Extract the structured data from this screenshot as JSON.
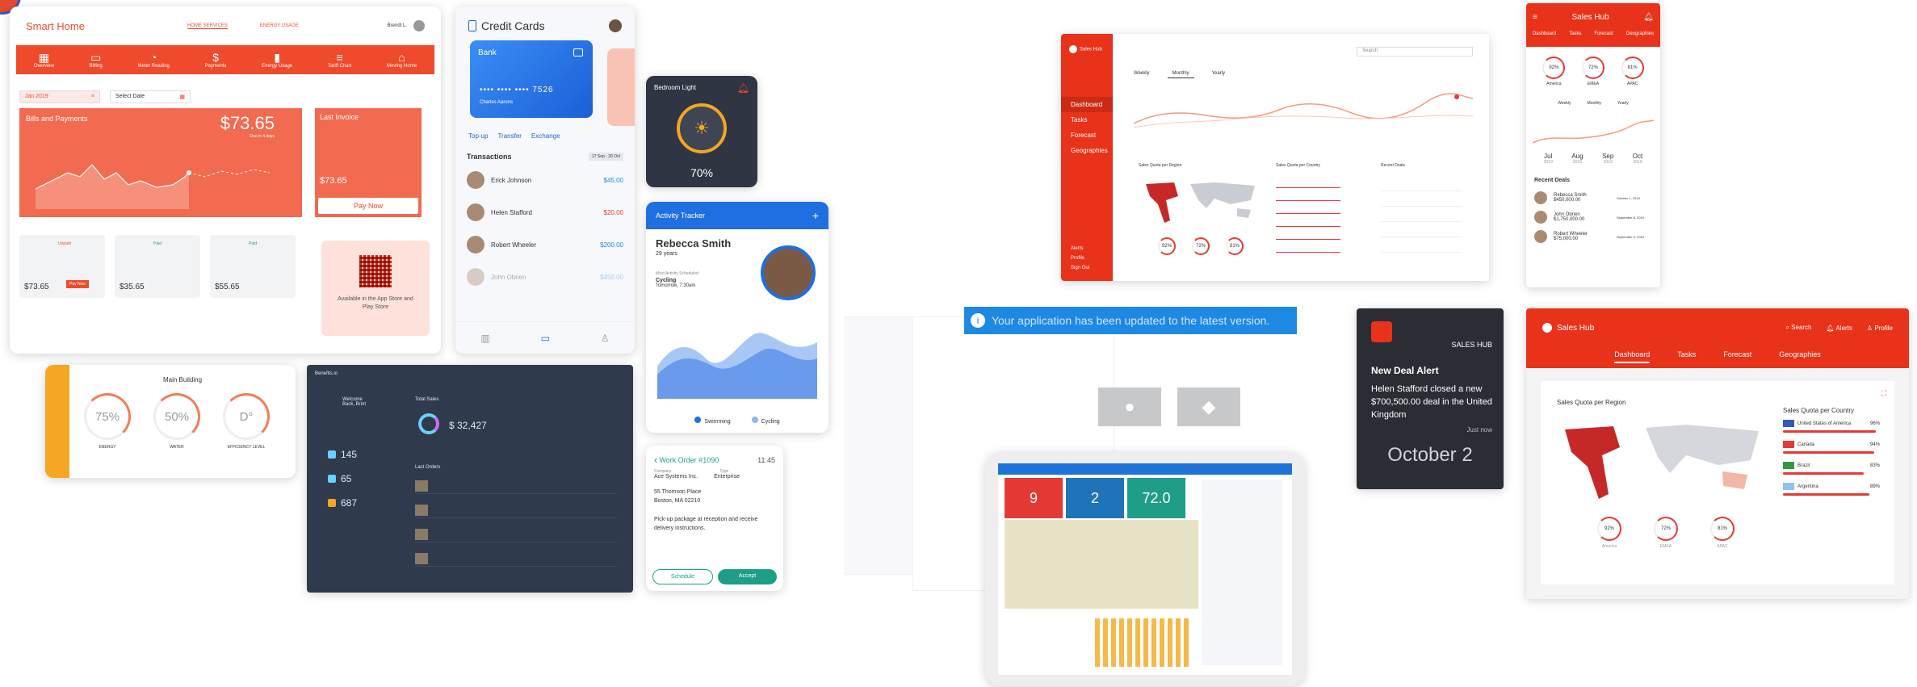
{
  "smart_home": {
    "title": "Smart Home",
    "tab1": "HOME SERVICES",
    "tab2": "ENERGY USAGE",
    "user": "Brendt L.",
    "nav": [
      {
        "icon": "grid-icon",
        "label": "Overview"
      },
      {
        "icon": "card-icon",
        "label": "Billing"
      },
      {
        "icon": "pie-icon",
        "label": "Meter Reading"
      },
      {
        "icon": "dollar-icon",
        "label": "Payments"
      },
      {
        "icon": "bars-icon",
        "label": "Energy Usage"
      },
      {
        "icon": "tariff-icon",
        "label": "Tariff Chart"
      },
      {
        "icon": "house-icon",
        "label": "Moving Home"
      }
    ],
    "date_value": "Jan 2019",
    "select_date": "Select Date",
    "bills_title": "Bills and Payments",
    "bills_amount": "$73.65",
    "bills_sub": "Due in 4 days",
    "last_invoice": "Last Invoice",
    "invoice_amount": "$73.65",
    "pay_now": "Pay Now",
    "bills": [
      {
        "amount": "$73.65",
        "status": "Unpaid",
        "btn": "Pay Now"
      },
      {
        "amount": "$35.65",
        "status": "Paid"
      },
      {
        "amount": "$55.65",
        "status": "Paid"
      }
    ],
    "app_store": "Available in the App Store and Play Store"
  },
  "credit_cards": {
    "title": "Credit Cards",
    "bank": "Bank",
    "card_number": "•••• •••• •••• 7526",
    "holder": "Charles Aarons",
    "actions": [
      "Top-up",
      "Transfer",
      "Exchange"
    ],
    "transactions_title": "Transactions",
    "filter": "17 Sep - 20 Oct",
    "transactions": [
      {
        "name": "Erick Johnson",
        "amount": "$45.00",
        "color": "#1e88e5"
      },
      {
        "name": "Helen Stafford",
        "amount": "$20.00",
        "color": "#e53935"
      },
      {
        "name": "Robert Wheeler",
        "amount": "$200.00",
        "color": "#1e88e5"
      },
      {
        "name": "John Obrien",
        "amount": "$450.00",
        "color": "#1e88e5"
      }
    ]
  },
  "bedroom": {
    "title": "Bedroom Light",
    "value": "70%"
  },
  "activity": {
    "title": "Activity Tracker",
    "name": "Rebecca Smith",
    "age": "29 years",
    "recent_label": "Most Activity Scheduled",
    "activity": "Cycling",
    "time": "Tomorrow, 7:30am",
    "legend": [
      "Swimming",
      "Cycling"
    ]
  },
  "work_order": {
    "title": "Work Order #1090",
    "time": "11:45",
    "company_label": "Company",
    "company": "Ace Systems Inc.",
    "type_label": "Type",
    "type": "Enterprise",
    "address": "55 Thomson Place\nBoston, MA 02210",
    "notes": "Pick-up package at reception and receive delivery instructions.",
    "schedule": "Schedule",
    "accept": "Accept"
  },
  "building": {
    "title": "Main Building",
    "gauges": [
      {
        "value": "75%",
        "label": "ENERGY"
      },
      {
        "value": "50%",
        "label": "WATER"
      },
      {
        "value": "D°",
        "label": "EFFICIENCY LEVEL"
      }
    ]
  },
  "dark_dash": {
    "brand": "Benefits.io",
    "welcome": "Welcome Back, Brint",
    "total_sales": "Total Sales",
    "sales_value": "$ 32,427",
    "stats": [
      "145",
      "65",
      "687"
    ],
    "last_orders": "Last Orders"
  },
  "update_banner": "Your application has been updated to the latest version.",
  "alert": {
    "brand": "SALES HUB",
    "title": "New Deal Alert",
    "body": "Helen Stafford closed a new $700,500.00 deal in the United Kingdom",
    "when": "Just now",
    "date": "October 2"
  },
  "sales_hub_desktop": {
    "brand": "Sales Hub",
    "search": "Search",
    "menu": [
      "Dashboard",
      "Tasks",
      "Forecast",
      "Geographies"
    ],
    "bottom_menu": [
      "Alerts",
      "Profile",
      "Sign Out"
    ],
    "tabs": [
      "Weekly",
      "Monthly",
      "Yearly"
    ],
    "quota_region": "Sales Quota per Region",
    "quota_country": "Sales Quota per Country",
    "recent_deals": "Recent Deals",
    "rings": [
      "92%",
      "72%",
      "81%"
    ]
  },
  "sales_hub_mobile": {
    "brand": "Sales Hub",
    "tabs": [
      "Dashboard",
      "Tasks",
      "Forecast",
      "Geographies"
    ],
    "rings": [
      {
        "v": "92%",
        "l": "America"
      },
      {
        "v": "72%",
        "l": "EMEA"
      },
      {
        "v": "81%",
        "l": "APAC"
      }
    ],
    "range": [
      "Weekly",
      "Monthly",
      "Yearly"
    ],
    "months": [
      "Jul",
      "Aug",
      "Sep",
      "Oct"
    ],
    "year": "2019",
    "recent": "Recent Deals",
    "deals": [
      {
        "name": "Rebecca Smith",
        "amount": "$450,000.00",
        "date": "October 1, 2019"
      },
      {
        "name": "John Obrien",
        "amount": "$1,750,000.00",
        "date": "September 8, 2019"
      },
      {
        "name": "Robert Wheeler",
        "amount": "$75,000.00",
        "date": "September 3, 2019"
      }
    ]
  },
  "sales_hub_wide": {
    "brand": "Sales Hub",
    "search": "Search",
    "alerts": "Alerts",
    "profile": "Profile",
    "tabs": [
      "Dashboard",
      "Tasks",
      "Forecast",
      "Geographies"
    ],
    "quota_region": "Sales Quota per Region",
    "quota_country": "Sales Quota per Country",
    "countries": [
      {
        "name": "United States of America",
        "pct": "96%"
      },
      {
        "name": "Canada",
        "pct": "94%"
      },
      {
        "name": "Brazil",
        "pct": "83%"
      },
      {
        "name": "Argentina",
        "pct": "89%"
      }
    ],
    "rings": [
      {
        "v": "92%",
        "l": "America"
      },
      {
        "v": "72%",
        "l": "EMEA"
      },
      {
        "v": "81%",
        "l": "APAC"
      }
    ]
  },
  "tablet": {
    "tiles": [
      "9",
      "2",
      "72.0"
    ]
  },
  "colors": {
    "primary": "#f04a2c",
    "blue": "#1976d2",
    "dark": "#2f3a4c",
    "teal": "#1e9e86"
  }
}
